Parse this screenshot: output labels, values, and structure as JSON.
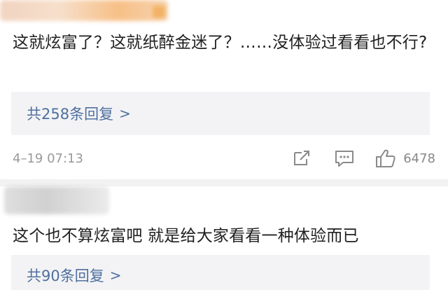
{
  "comments": [
    {
      "text": "这就炫富了？这就纸醉金迷了？……没体验过看看也不行?",
      "replies_label": "共258条回复",
      "reply_chevron": ">",
      "timestamp": "4–19 07:13",
      "likes": "6478"
    },
    {
      "text": "这个也不算炫富吧 就是给大家看看一种体验而已",
      "replies_label": "共90条回复",
      "reply_chevron": ">"
    }
  ],
  "icons": {
    "share": "share-icon",
    "comment": "comment-icon",
    "like": "thumbs-up-icon"
  },
  "colors": {
    "link": "#4f6f9f",
    "meta": "#9a9a9a",
    "reply_bg": "#f3f3f5"
  }
}
